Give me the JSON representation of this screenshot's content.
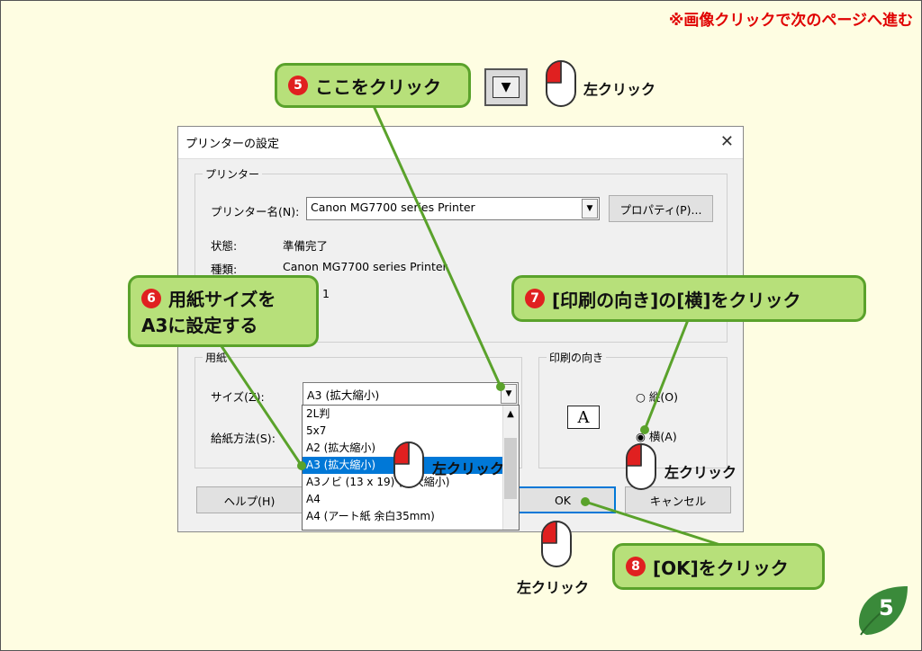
{
  "hint": "※画像クリックで次のページへ進む",
  "dialog": {
    "title": "プリンターの設定",
    "close_label": "X",
    "printer_group": "プリンター",
    "printer_name_label": "プリンター名(N):",
    "printer_name_value": "Canon MG7700 series Printer",
    "properties_button": "プロパティ(P)...",
    "status_label": "状態:",
    "status_value": "準備完了",
    "type_label": "種類:",
    "type_value": "Canon MG7700 series Printer",
    "partial_value": "1",
    "paper_group": "用紙",
    "size_label": "サイズ(Z):",
    "size_value": "A3 (拡大縮小)",
    "source_label": "給紙方法(S):",
    "orientation_group": "印刷の向き",
    "portrait_label": "縦(O)",
    "landscape_label": "横(A)",
    "help_button": "ヘルプ(H)",
    "ok_button": "OK",
    "cancel_button": "キャンセル",
    "dropdown_items": [
      "2L判",
      "5x7",
      "A2 (拡大縮小)",
      "A3 (拡大縮小)",
      "A3ノビ (13 x 19) (拡大縮小)",
      "A4",
      "A4 (アート紙 余白35mm)"
    ]
  },
  "callouts": {
    "step5": {
      "num": "5",
      "text": "ここをクリック"
    },
    "step6": {
      "num": "6",
      "text1": "用紙サイズを",
      "text2": "A3に設定する"
    },
    "step7": {
      "num": "7",
      "text": "[印刷の向き]の[横]をクリック"
    },
    "step8": {
      "num": "8",
      "text": "[OK]をクリック"
    }
  },
  "left_click": "左クリック",
  "page_number": "5",
  "colors": {
    "accent": "#0078d7",
    "callout_bg": "#b7e07a",
    "callout_border": "#5aa22b",
    "step_red": "#e02020"
  }
}
